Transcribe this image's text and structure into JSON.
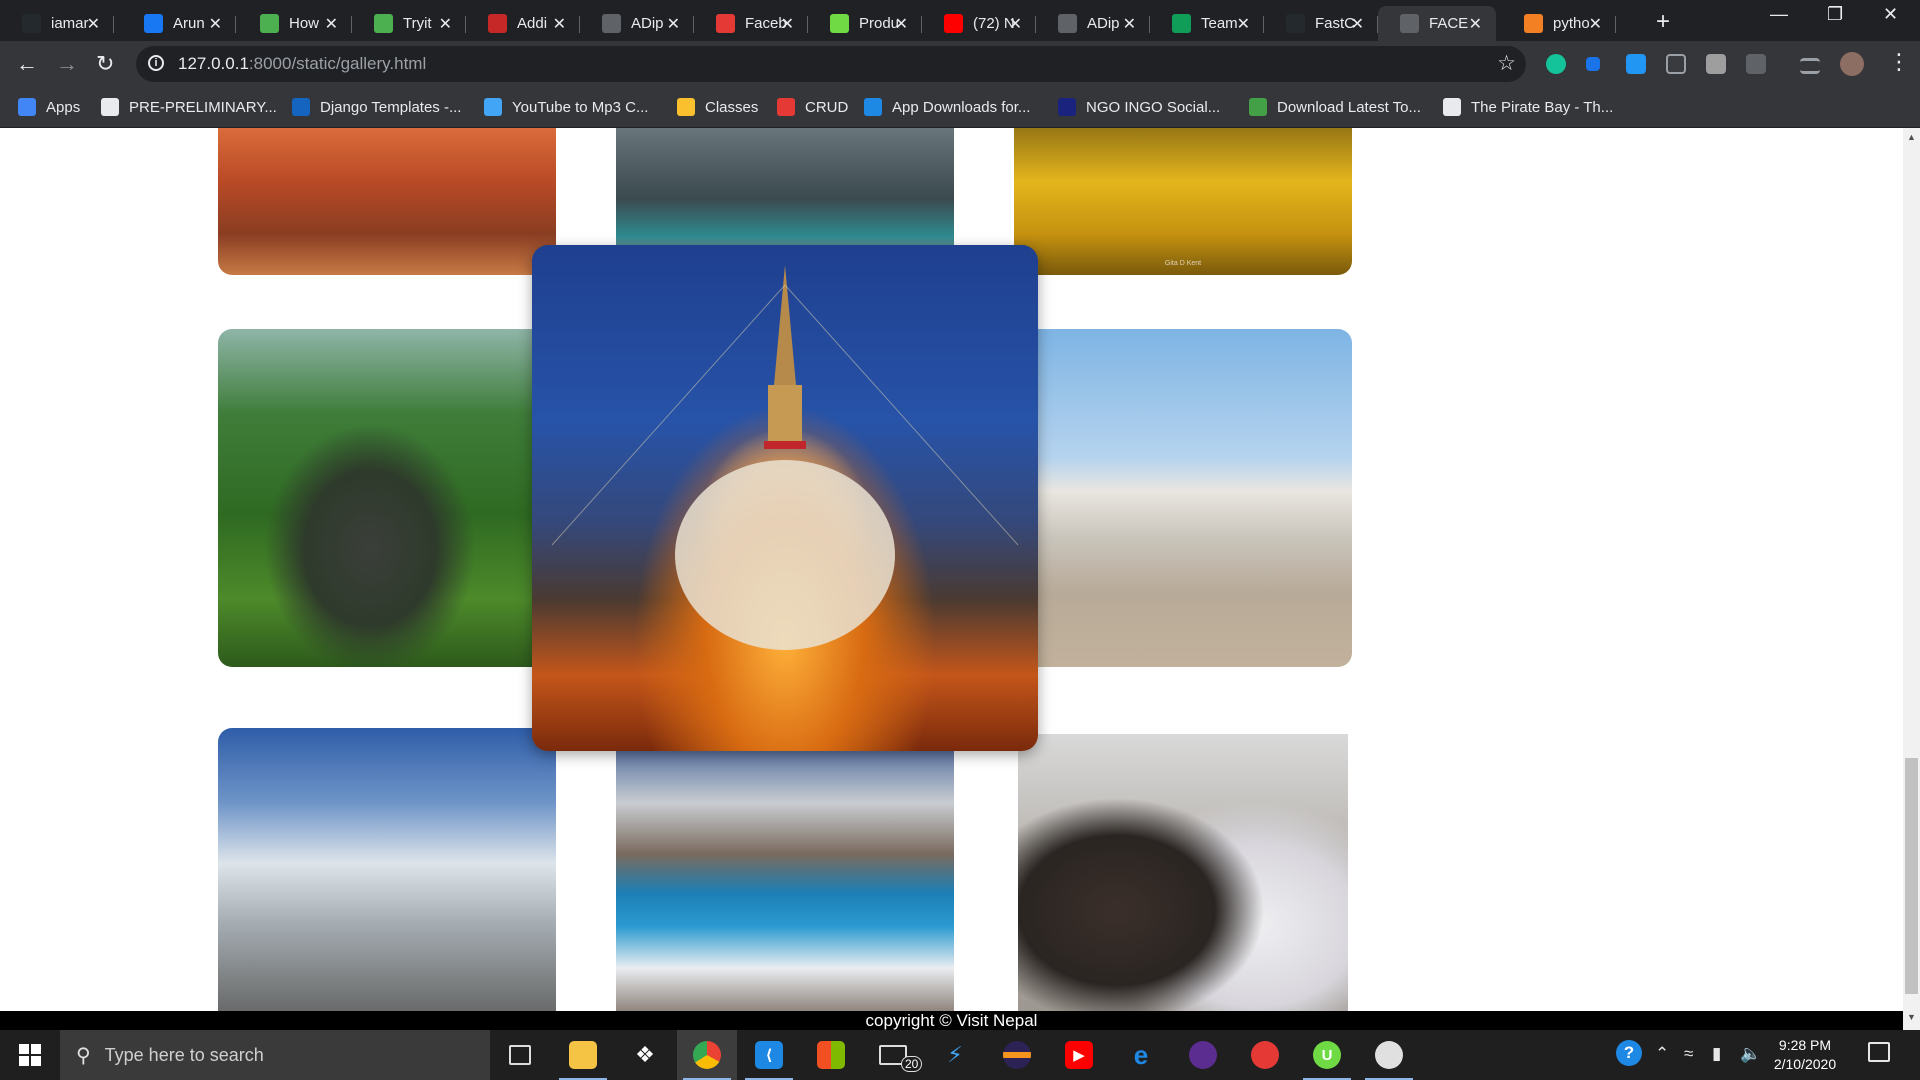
{
  "browser": {
    "tabs": [
      {
        "title": "iamar",
        "icon": "github-icon",
        "color": "#24292e"
      },
      {
        "title": "Arun",
        "icon": "facebook-icon",
        "color": "#1877f2"
      },
      {
        "title": "How",
        "icon": "w3schools-icon",
        "color": "#4caf50"
      },
      {
        "title": "Tryit",
        "icon": "w3schools-icon",
        "color": "#4caf50"
      },
      {
        "title": "Addi",
        "icon": "django-icon",
        "color": "#c62828"
      },
      {
        "title": "ADip",
        "icon": "globe-icon",
        "color": "#5f6368"
      },
      {
        "title": "Faceb",
        "icon": "store-icon",
        "color": "#e53935"
      },
      {
        "title": "Produ",
        "icon": "upwork-icon",
        "color": "#6fda44"
      },
      {
        "title": "(72) N",
        "icon": "youtube-icon",
        "color": "#ff0000"
      },
      {
        "title": "ADip",
        "icon": "contact-icon",
        "color": "#5f6368"
      },
      {
        "title": "Team",
        "icon": "plus-square-icon",
        "color": "#0f9d58"
      },
      {
        "title": "FastC",
        "icon": "github-icon",
        "color": "#24292e"
      },
      {
        "title": "FACE",
        "icon": "globe-icon",
        "color": "#5f6368",
        "active": true
      },
      {
        "title": "pytho",
        "icon": "stackoverflow-icon",
        "color": "#f48024"
      }
    ],
    "url_host": "127.0.0.1",
    "url_path": ":8000/static/gallery.html",
    "bookmarks": [
      {
        "label": "Apps",
        "icon": "apps-grid-icon",
        "color": "#4285f4"
      },
      {
        "label": "PRE-PRELIMINARY...",
        "icon": "globe-icon",
        "color": "#e8eaed"
      },
      {
        "label": "Django Templates -...",
        "icon": "django-icon",
        "color": "#1565c0"
      },
      {
        "label": "YouTube to Mp3 C...",
        "icon": "cloud-download-icon",
        "color": "#42a5f5"
      },
      {
        "label": "Classes",
        "icon": "classroom-icon",
        "color": "#fbc02d"
      },
      {
        "label": "CRUD",
        "icon": "vue-icon",
        "color": "#e53935"
      },
      {
        "label": "App Downloads for...",
        "icon": "download-icon",
        "color": "#1e88e5"
      },
      {
        "label": "NGO INGO Social...",
        "icon": "ngo-icon",
        "color": "#1a237e"
      },
      {
        "label": "Download Latest To...",
        "icon": "utorrent-icon",
        "color": "#43a047"
      },
      {
        "label": "The Pirate Bay - Th...",
        "icon": "piratebay-icon",
        "color": "#e8eaed"
      }
    ]
  },
  "gallery": {
    "footer": "copyright © Visit Nepal",
    "photos": [
      {
        "name": "durbar-square-photo"
      },
      {
        "name": "mountain-lake-photo"
      },
      {
        "name": "golden-buddha-photo",
        "caption": "Gita D Kent"
      },
      {
        "name": "elephant-safari-photo"
      },
      {
        "name": "janaki-temple-photo"
      },
      {
        "name": "everest-base-camp-photo"
      },
      {
        "name": "tilicho-lake-photo"
      },
      {
        "name": "nepali-couple-photo"
      },
      {
        "name": "boudhanath-stupa-photo"
      }
    ]
  },
  "taskbar": {
    "search_placeholder": "Type here to search",
    "mail_badge": "20",
    "time": "9:28 PM",
    "date": "2/10/2020"
  }
}
